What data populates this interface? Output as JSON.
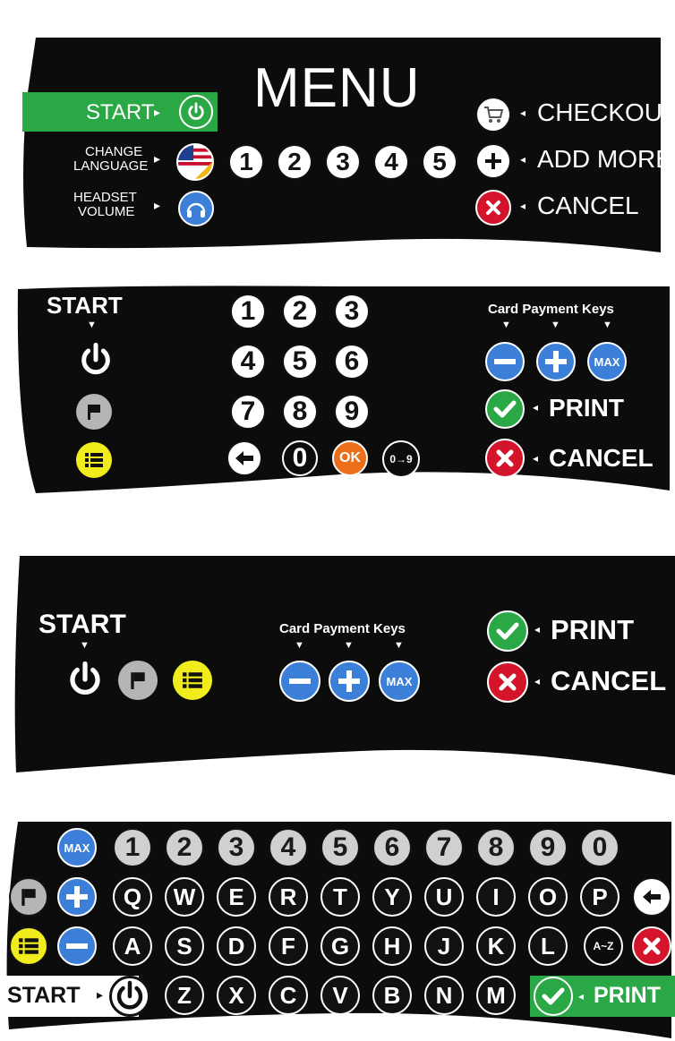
{
  "panel1": {
    "title": "MENU",
    "start_label": "START",
    "change_language_label_1": "CHANGE",
    "change_language_label_2": "LANGUAGE",
    "headset_volume_label_1": "HEADSET",
    "headset_volume_label_2": "VOLUME",
    "number_keys": [
      "1",
      "2",
      "3",
      "4",
      "5"
    ],
    "checkout_label": "CHECKOUT",
    "add_more_label": "ADD MORE",
    "cancel_label": "CANCEL"
  },
  "panel2": {
    "start_label": "START",
    "card_payment_label": "Card Payment Keys",
    "keypad": [
      "1",
      "2",
      "3",
      "4",
      "5",
      "6",
      "7",
      "8",
      "9"
    ],
    "zero_key": "0",
    "ok_key": "OK",
    "mode_key": "0→9",
    "max_key": "MAX",
    "print_label": "PRINT",
    "cancel_label": "CANCEL"
  },
  "panel3": {
    "start_label": "START",
    "card_payment_label": "Card Payment Keys",
    "max_key": "MAX",
    "print_label": "PRINT",
    "cancel_label": "CANCEL"
  },
  "panel4": {
    "max_key": "MAX",
    "number_row": [
      "1",
      "2",
      "3",
      "4",
      "5",
      "6",
      "7",
      "8",
      "9",
      "0"
    ],
    "row_q": [
      "Q",
      "W",
      "E",
      "R",
      "T",
      "Y",
      "U",
      "I",
      "O",
      "P"
    ],
    "row_a": [
      "A",
      "S",
      "D",
      "F",
      "G",
      "H",
      "J",
      "K",
      "L"
    ],
    "az_key": "A~Z",
    "row_z": [
      "Z",
      "X",
      "C",
      "V",
      "B",
      "N",
      "M"
    ],
    "start_label": "START",
    "print_label": "PRINT"
  },
  "colors": {
    "panel": "#0c0c0c",
    "green": "#2aa845",
    "blue": "#3b7fd9",
    "red": "#d4142a",
    "orange": "#ec6f1b",
    "yellow": "#f1ec1c",
    "grey": "#b5b5b5"
  },
  "icons": [
    "power-icon",
    "flag-icon",
    "list-icon",
    "cart-icon",
    "plus-icon",
    "minus-icon",
    "check-icon",
    "x-icon",
    "back-arrow-icon",
    "headset-icon",
    "us-spain-flag-icon",
    "triangle-arrow-icon"
  ]
}
